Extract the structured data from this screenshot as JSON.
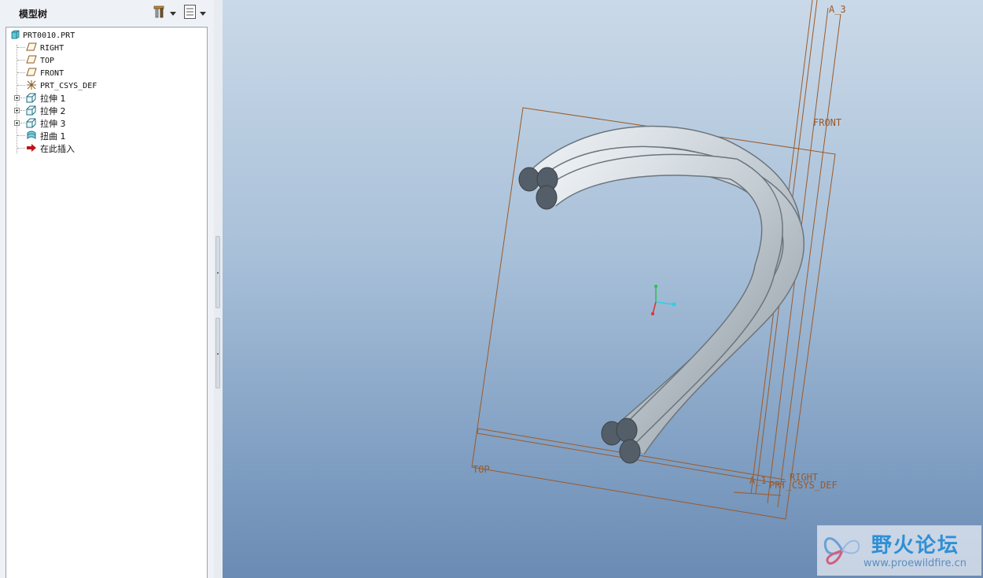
{
  "model_tree": {
    "title": "模型树",
    "items": [
      {
        "label": "PRT0010.PRT",
        "icon": "part-icon"
      },
      {
        "label": "RIGHT",
        "icon": "datum-plane-icon"
      },
      {
        "label": "TOP",
        "icon": "datum-plane-icon"
      },
      {
        "label": "FRONT",
        "icon": "datum-plane-icon"
      },
      {
        "label": "PRT_CSYS_DEF",
        "icon": "coordinate-system-icon"
      },
      {
        "label": "拉伸 1",
        "icon": "extrude-icon"
      },
      {
        "label": "拉伸 2",
        "icon": "extrude-icon"
      },
      {
        "label": "拉伸 3",
        "icon": "extrude-icon"
      },
      {
        "label": "扭曲 1",
        "icon": "warp-icon"
      },
      {
        "label": "在此插入",
        "icon": "insert-here-arrow-icon"
      }
    ]
  },
  "toolbar": {
    "settings_icon": "tree-settings-tools-icon",
    "columns_icon": "tree-columns-icon"
  },
  "viewport": {
    "datum_labels": {
      "front": "FRONT",
      "top": "TOP",
      "right": "RIGHT",
      "csys": "PRT_CSYS_DEF",
      "axis_a1": "A_1",
      "axis_a3": "A_3"
    }
  },
  "watermark": {
    "name": "野火论坛",
    "url": "www.proewildfire.cn"
  },
  "colors": {
    "datum": "#9a5a2a",
    "background_top": "#cad9e8",
    "background_bottom": "#6b8bb4",
    "rope": "#c4ccd3"
  }
}
